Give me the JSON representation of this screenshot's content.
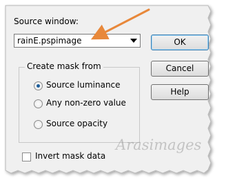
{
  "dialog": {
    "source_window_label": "Source window:",
    "source_window_value": "rainE.pspimage",
    "buttons": {
      "ok": "OK",
      "cancel": "Cancel",
      "help": "Help"
    },
    "mask_group": {
      "title": "Create mask from",
      "options": [
        {
          "label": "Source luminance",
          "checked": true
        },
        {
          "label": "Any non-zero value",
          "checked": false
        },
        {
          "label": "Source opacity",
          "checked": false
        }
      ]
    },
    "invert_mask": {
      "label": "Invert mask data",
      "checked": false
    }
  },
  "watermark": "Arasimages",
  "colors": {
    "dialog_background": "#f0f0f0",
    "annotation_arrow": "#e8883a",
    "selected_radio": "#1c5d9a"
  },
  "icons": {
    "dropdown": "chevron-down-icon",
    "annotation": "arrow-pointer"
  }
}
